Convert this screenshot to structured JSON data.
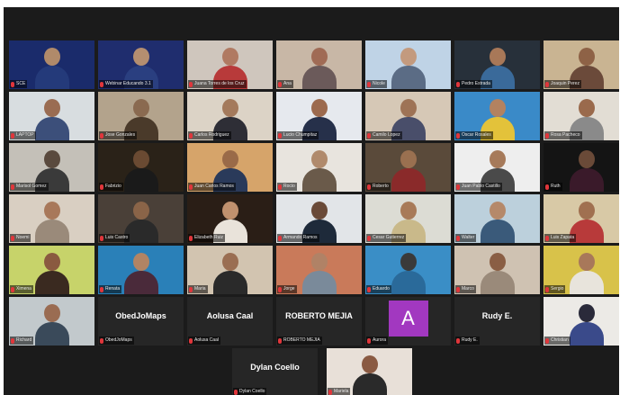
{
  "colors": {
    "background": "#1b1b1b",
    "tile": "#262626",
    "active_speaker": "#c9d64a",
    "muted_mic": "#e0363b",
    "avatar": "#a238c0"
  },
  "rows": [
    [
      {
        "label": "SCE",
        "video": [
          "#1a2b6b",
          "#b08a6a",
          "#243a7a"
        ],
        "active": true
      },
      {
        "label": "Webinar Educando 3.1",
        "video": [
          "#1f2d6e",
          "#b48e70",
          "#2a3f80"
        ]
      },
      {
        "label": "Juana Torres de los Cruz",
        "video": [
          "#cfc6bd",
          "#b07a62",
          "#b83a3a"
        ]
      },
      {
        "label": "Ana",
        "video": [
          "#c8b7a6",
          "#a06b55",
          "#6b5a5a"
        ]
      },
      {
        "label": "Nicole",
        "video": [
          "#bfd3e6",
          "#c39a7e",
          "#5b6c85"
        ]
      },
      {
        "label": "Pedro Estrada",
        "video": [
          "#27303a",
          "#a87858",
          "#3a6a9a"
        ]
      },
      {
        "label": "Joaquin Perez",
        "video": [
          "#c9b492",
          "#8e6246",
          "#6b4a3a"
        ]
      }
    ],
    [
      {
        "label": "LAPTOP",
        "video": [
          "#d8dde0",
          "#9a6c52",
          "#3c4f7a"
        ]
      },
      {
        "label": "Jose Gonzales",
        "video": [
          "#b3a38c",
          "#8a6a50",
          "#4a3a2a"
        ]
      },
      {
        "label": "Carlos Rodriguez",
        "video": [
          "#dcd3c6",
          "#a47a5c",
          "#2e2e36"
        ]
      },
      {
        "label": "Lucio Chumpitaz",
        "video": [
          "#e6e9ee",
          "#9c6a4e",
          "#26304a"
        ]
      },
      {
        "label": "Camilo Lopez",
        "video": [
          "#d6c8b6",
          "#9e7356",
          "#494e6a"
        ]
      },
      {
        "label": "Oscar Rosales",
        "video": [
          "#3a8ac8",
          "#b38260",
          "#e3c23a"
        ]
      },
      {
        "label": "Rosa Pacheco",
        "video": [
          "#e2ddd4",
          "#9a6a4c",
          "#8a8a8a"
        ]
      }
    ],
    [
      {
        "label": "Marisol Gomez",
        "video": [
          "#c4c0b8",
          "#5a4a3e",
          "#3a3a3a"
        ]
      },
      {
        "label": "Fabrizio",
        "video": [
          "#2a2218",
          "#6a4a32",
          "#1a1a1a"
        ]
      },
      {
        "label": "Juan Carlos Ramos",
        "video": [
          "#d6a46a",
          "#9a6a48",
          "#2a3a5a"
        ]
      },
      {
        "label": "Rocio",
        "video": [
          "#e8e4de",
          "#b08a6c",
          "#6a5a4a"
        ]
      },
      {
        "label": "Roberto",
        "video": [
          "#5a4a3a",
          "#9a7050",
          "#8a2a2a"
        ]
      },
      {
        "label": "Juan Pablo Castillo",
        "video": [
          "#eeeeee",
          "#a67a5a",
          "#4a4a4a"
        ]
      },
      {
        "label": "Ruth",
        "video": [
          "#141414",
          "#6a4a38",
          "#3a1a2a"
        ]
      }
    ],
    [
      {
        "label": "Noemi",
        "video": [
          "#d9cfc2",
          "#a8785a",
          "#9a8a7a"
        ]
      },
      {
        "label": "Luis Castro",
        "video": [
          "#4a4038",
          "#8a6448",
          "#2a2a2a"
        ]
      },
      {
        "label": "Elizabeth Ruiz",
        "video": [
          "#2a1e16",
          "#c0916e",
          "#e9e3da"
        ]
      },
      {
        "label": "Armando Ramos",
        "video": [
          "#e2e5e8",
          "#6a4a38",
          "#1e2a3a"
        ]
      },
      {
        "label": "Cesar Gutierrez",
        "video": [
          "#dcdcd4",
          "#a87a58",
          "#c9b98a"
        ]
      },
      {
        "label": "Walter",
        "video": [
          "#bcd0dc",
          "#b5896a",
          "#3a5a7a"
        ]
      },
      {
        "label": "Luis Zapata",
        "video": [
          "#d8c9a6",
          "#a07050",
          "#b83a3a"
        ]
      }
    ],
    [
      {
        "label": "Ximena",
        "video": [
          "#c7d36a",
          "#8a5a40",
          "#3a2a20"
        ]
      },
      {
        "label": "Renata",
        "video": [
          "#2a80b8",
          "#b18464",
          "#4a2a3a"
        ]
      },
      {
        "label": "Maria",
        "video": [
          "#d2c4b0",
          "#9a6e52",
          "#2a2a2a"
        ]
      },
      {
        "label": "Jorge",
        "video": [
          "#c97a5a",
          "#b08266",
          "#7a8a9a"
        ]
      },
      {
        "label": "Eduardo",
        "video": [
          "#3a8ec6",
          "#3a3a3a",
          "#2a6a9a"
        ]
      },
      {
        "label": "Marco",
        "video": [
          "#cfc2b2",
          "#8a5e44",
          "#9a8a7a"
        ]
      },
      {
        "label": "Sergio",
        "video": [
          "#d8c24a",
          "#a8785a",
          "#e8e4dc"
        ]
      }
    ],
    [
      {
        "label": "Richard",
        "video": [
          "#c2c9cc",
          "#9a6c52",
          "#3a4a5a"
        ]
      },
      {
        "label": "ObedJoMaps",
        "name": "ObedJoMaps"
      },
      {
        "label": "Aolusa Caal",
        "name": "Aolusa Caal"
      },
      {
        "label": "ROBERTO MEJIA",
        "name": "ROBERTO MEJIA"
      },
      {
        "label": "Aurora",
        "avatar": "A"
      },
      {
        "label": "Rudy E.",
        "name": "Rudy E."
      },
      {
        "label": "Christian",
        "video": [
          "#eceae6",
          "#2a2a3a",
          "#3a4a8a"
        ]
      }
    ],
    [
      {
        "label": "Dylan Coello",
        "name": "Dylan Coello"
      },
      {
        "label": "Mariela",
        "video": [
          "#e8e0d8",
          "#8a5a42",
          "#2a2a2a"
        ]
      }
    ]
  ]
}
